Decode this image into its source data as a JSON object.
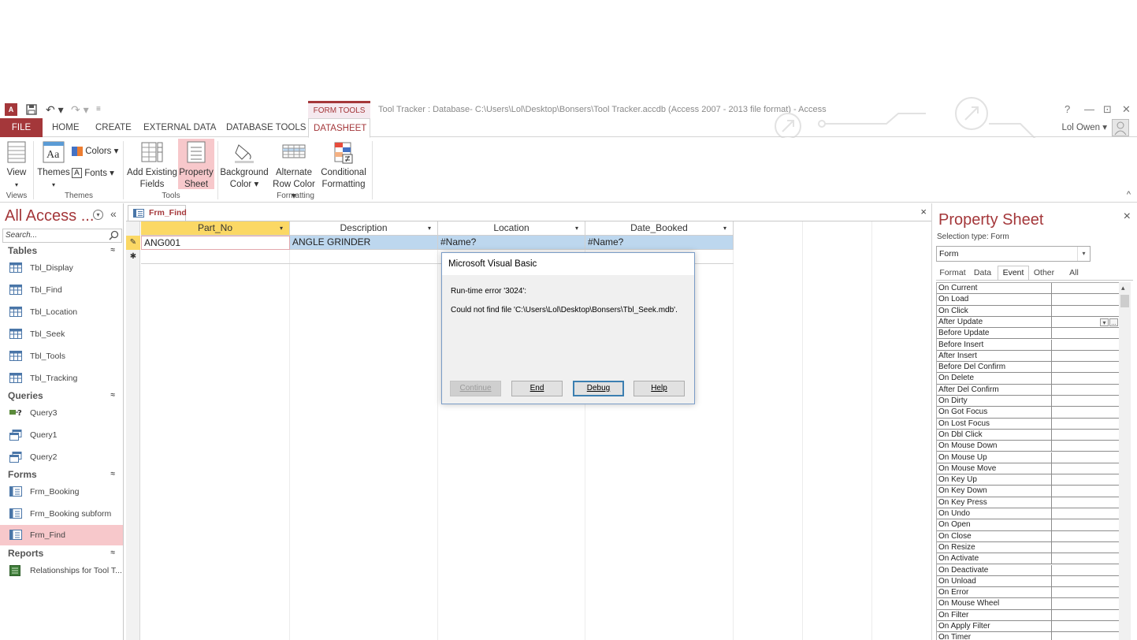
{
  "app": {
    "window_title": "Tool Tracker : Database- C:\\Users\\Lol\\Desktop\\Bonsers\\Tool Tracker.accdb (Access 2007 - 2013 file format) - Access",
    "contextual_tab_group": "FORM TOOLS",
    "access_icon": "A",
    "window_controls": {
      "help": "?",
      "minimize": "—",
      "restore": "⊡",
      "close": "✕"
    },
    "user_name": "Lol Owen",
    "accent_color": "#a4373a"
  },
  "tabs": [
    "FILE",
    "HOME",
    "CREATE",
    "EXTERNAL DATA",
    "DATABASE TOOLS",
    "DATASHEET"
  ],
  "ribbon": {
    "view": {
      "label": "View",
      "arrow": "▾"
    },
    "themes": {
      "label": "Themes",
      "arrow": "▾"
    },
    "colors": "Colors",
    "fonts": "Fonts",
    "fonts_icon": "A",
    "add_existing": {
      "line1": "Add Existing",
      "line2": "Fields"
    },
    "property_sheet": {
      "line1": "Property",
      "line2": "Sheet"
    },
    "background_color": {
      "line1": "Background",
      "line2": "Color"
    },
    "alternate_row_color": {
      "line1": "Alternate",
      "line2": "Row Color"
    },
    "conditional_formatting": {
      "line1": "Conditional",
      "line2": "Formatting"
    },
    "groups": [
      "Views",
      "Themes",
      "Tools",
      "Formatting"
    ],
    "collapse_icon": "^"
  },
  "nav": {
    "title": "All Access ...",
    "menu_glyph": "▾",
    "collapse_glyph": "«",
    "search_placeholder": "Search...",
    "group_chevron": "≈",
    "groups": [
      {
        "name": "Tables",
        "items": [
          "Tbl_Display",
          "Tbl_Find",
          "Tbl_Location",
          "Tbl_Seek",
          "Tbl_Tools",
          "Tbl_Tracking"
        ]
      },
      {
        "name": "Queries",
        "items": [
          "Query3",
          "Query1",
          "Query2"
        ]
      },
      {
        "name": "Forms",
        "items": [
          "Frm_Booking",
          "Frm_Booking subform",
          "Frm_Find"
        ]
      },
      {
        "name": "Reports",
        "items": [
          "Relationships for Tool T..."
        ]
      }
    ],
    "selected_item": "Frm_Find"
  },
  "document": {
    "tab_label": "Frm_Find",
    "close_glyph": "×",
    "columns": [
      "Part_No",
      "Description",
      "Location",
      "Date_Booked"
    ],
    "column_dropdown_glyph": "▾",
    "sorted_column": "Part_No",
    "rows": [
      [
        "ANG001",
        "ANGLE GRINDER",
        "#Name?",
        "#Name?"
      ]
    ],
    "current_row_marker": "✎",
    "new_row_marker": "✱"
  },
  "dialog": {
    "title": "Microsoft Visual Basic",
    "error_code": "Run-time error '3024':",
    "message": "Could not find file 'C:\\Users\\Lol\\Desktop\\Bonsers\\Tbl_Seek.mdb'.",
    "buttons": {
      "continue": "Continue",
      "end": "End",
      "debug": "Debug",
      "help": "Help"
    }
  },
  "property_sheet": {
    "title": "Property Sheet",
    "close_glyph": "×",
    "selection_type": "Selection type:  Form",
    "object": "Form",
    "combo_arrow": "▾",
    "tabs": [
      "Format",
      "Data",
      "Event",
      "Other",
      "All"
    ],
    "active_tab": "Event",
    "selected_property": "After Update",
    "value_buttons": {
      "dropdown": "▾",
      "builder": "..."
    },
    "scroll_up": "▴",
    "properties": [
      "On Current",
      "On Load",
      "On Click",
      "After Update",
      "Before Update",
      "Before Insert",
      "After Insert",
      "Before Del Confirm",
      "On Delete",
      "After Del Confirm",
      "On Dirty",
      "On Got Focus",
      "On Lost Focus",
      "On Dbl Click",
      "On Mouse Down",
      "On Mouse Up",
      "On Mouse Move",
      "On Key Up",
      "On Key Down",
      "On Key Press",
      "On Undo",
      "On Open",
      "On Close",
      "On Resize",
      "On Activate",
      "On Deactivate",
      "On Unload",
      "On Error",
      "On Mouse Wheel",
      "On Filter",
      "On Apply Filter",
      "On Timer"
    ]
  }
}
